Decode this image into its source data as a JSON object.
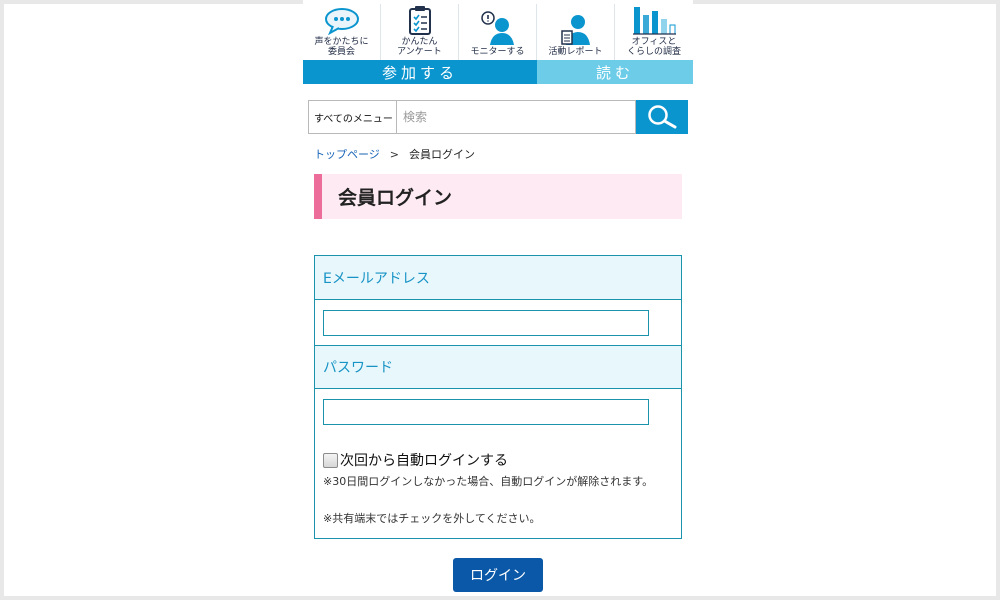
{
  "nav": {
    "items": [
      {
        "label": "声をかたちに\n委員会",
        "icon": "speech-bubble-icon"
      },
      {
        "label": "かんたん\nアンケート",
        "icon": "clipboard-icon"
      },
      {
        "label": "モニターする",
        "icon": "monitor-person-icon"
      },
      {
        "label": "活動レポート",
        "icon": "report-person-icon"
      },
      {
        "label": "オフィスと\nくらしの調査",
        "icon": "bar-chart-icon"
      }
    ],
    "tabs": {
      "join": "参加する",
      "read": "読む"
    },
    "colors": {
      "primary": "#0b95cf",
      "secondary": "#6dcde8"
    }
  },
  "search": {
    "select_label": "すべてのメニュー ▼",
    "placeholder": "検索",
    "button_icon": "search-icon"
  },
  "breadcrumb": {
    "home": "トップページ",
    "separator": ">",
    "current": "会員ログイン"
  },
  "page": {
    "title": "会員ログイン",
    "accent": "#ec6c9a"
  },
  "form": {
    "email_label": "Eメールアドレス",
    "email_value": "",
    "password_label": "パスワード",
    "password_value": "",
    "remember_label": "次回から自動ログインする",
    "note1": "※30日間ログインしなかった場合、自動ログインが解除されます。",
    "note2": "※共有端末ではチェックを外してください。",
    "submit_label": "ログイン"
  }
}
